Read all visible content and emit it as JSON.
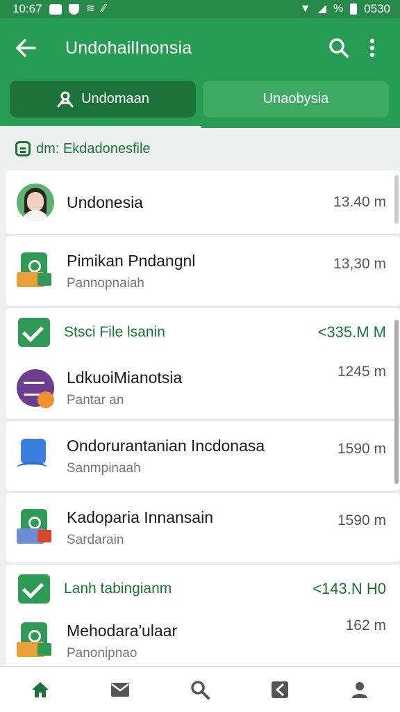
{
  "status_bar": {
    "time": "10:67",
    "right_text": "0530"
  },
  "app_bar": {
    "title": "UndohailInonsia",
    "back_icon": "arrow-left-icon",
    "search_icon": "search-icon",
    "menu_icon": "more-vert-icon"
  },
  "tabs": [
    {
      "label": "Undomaan",
      "icon": "people-icon",
      "active": true
    },
    {
      "label": "Unaobysia",
      "active": false
    }
  ],
  "section": {
    "label": "dm: Ekdadonesfile",
    "icon": "document-icon"
  },
  "items": [
    {
      "type": "file",
      "icon": "avatar",
      "name": "Undonesia",
      "subtitle": "",
      "size": "13.40 m"
    },
    {
      "type": "file",
      "icon": "app-green-orange",
      "name": "Pimikan Pndangnl",
      "subtitle": "Pannopnaiah",
      "size": "13,30 m"
    },
    {
      "type": "group",
      "icon": "check-icon",
      "name": "Stsci File lsanin",
      "size": "<335.M M"
    },
    {
      "type": "file",
      "icon": "purple-circle",
      "name": "LdkuoiMianotsia",
      "subtitle": "Pantar an",
      "size": "1245 m"
    },
    {
      "type": "file",
      "icon": "blue-app",
      "name": "Ondorurantanian Incdonasa",
      "subtitle": "Sanmpinaah",
      "size": "1590 m"
    },
    {
      "type": "file",
      "icon": "app-green-red",
      "name": "Kadoparia Innansain",
      "subtitle": "Sardarain",
      "size": "1590 m"
    },
    {
      "type": "group",
      "icon": "check-icon",
      "name": "Lanh tabingianm",
      "size": "<143.N H0"
    },
    {
      "type": "file",
      "icon": "app-green-orange",
      "name": "Mehodara'ulaar",
      "subtitle": "Panonipnao",
      "size": "162 m"
    }
  ],
  "bottom_nav": [
    "home-icon",
    "mail-icon",
    "search-icon",
    "share-icon",
    "person-icon"
  ],
  "colors": {
    "primary": "#279c54",
    "primary_dark": "#1b7339",
    "accent_text": "#1b7339"
  }
}
